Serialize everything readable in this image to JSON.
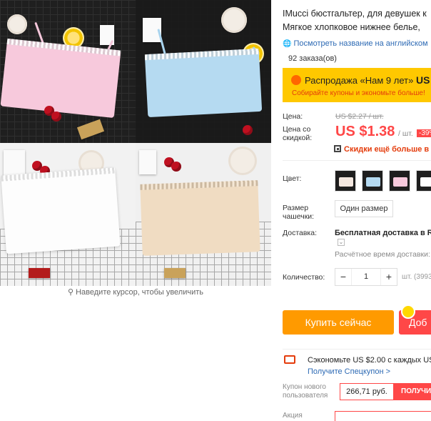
{
  "gallery": {
    "zoom_hint": "Наведите курсор, чтобы увеличить"
  },
  "product": {
    "title_line1": "IMucci бюстгальтер, для девушек к",
    "title_line2": "Мягкое хлопковое нижнее белье, ",
    "translate_link": "Посмотреть название на английском",
    "orders": "92 заказа(ов)"
  },
  "promo": {
    "title_prefix": "Распродажа «Нам 9 лет» ",
    "title_price": "US",
    "subtitle": "Собирайте купоны и экономьте больше!",
    "bg_color": "#ffc800"
  },
  "pricing": {
    "price_label": "Цена:",
    "old_price": "US $2.27 / шт.",
    "discount_label_1": "Цена со",
    "discount_label_2": "скидкой:",
    "price": "US $1.38",
    "per_unit": "/ шт.",
    "discount_badge": "-39%",
    "qr_promo": "Скидки ещё больше в пр",
    "accent_color": "#ff4747"
  },
  "options": {
    "color_label": "Цвет:",
    "colors": [
      "black",
      "blue",
      "pink",
      "white"
    ],
    "size_label_1": "Размер",
    "size_label_2": "чашечки:",
    "size_value": "Один размер"
  },
  "shipping": {
    "label": "Доставка:",
    "method": "Бесплатная доставка в Ru",
    "dropdown_glyph": "⌄",
    "estimated": "Расчётное время доставки:"
  },
  "quantity": {
    "label": "Количество:",
    "minus": "−",
    "value": "1",
    "plus": "+",
    "unit_available": "шт. (3993"
  },
  "actions": {
    "buy_now": "Купить сейчас",
    "add_to_cart": "Доб"
  },
  "coupons": {
    "save_text": "Сэкономьте US $2.00 с каждых US $",
    "get_link": "Получите Спецкупон >",
    "new_user_label_1": "Купон нового",
    "new_user_label_2": "пользователя",
    "new_user_amount": "266,71 руб.",
    "get_button": "ПОЛУЧИ",
    "action_label": "Акция"
  }
}
